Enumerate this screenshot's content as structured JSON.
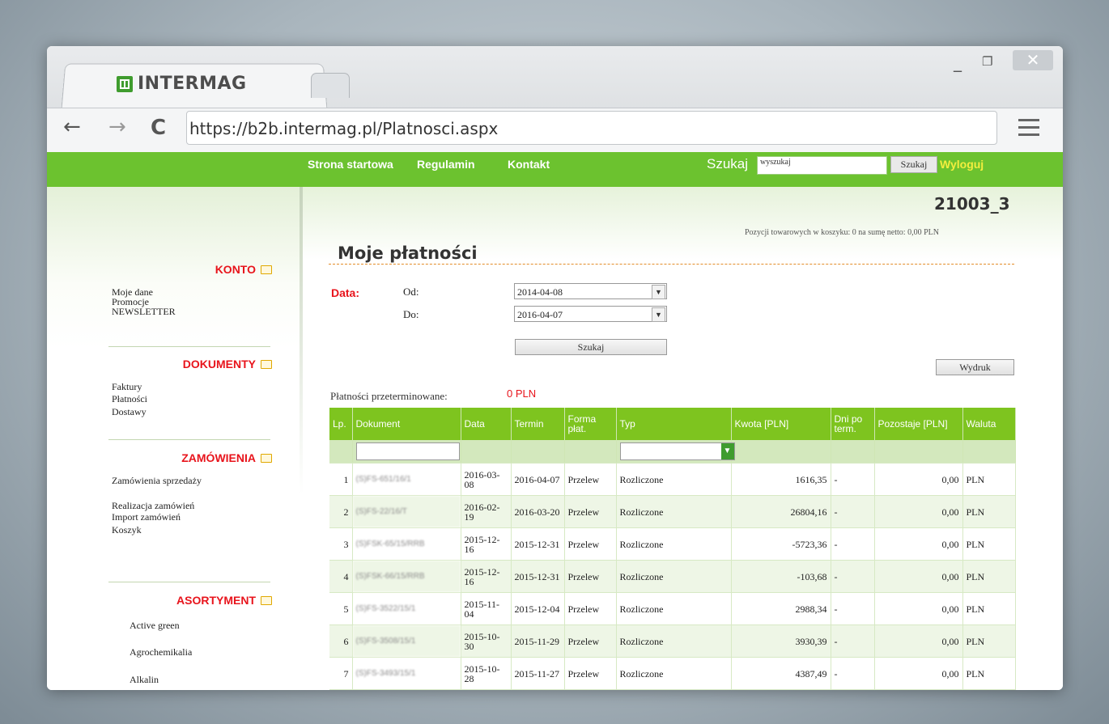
{
  "browser": {
    "tab_title": "INTERMAG",
    "url": "https://b2b.intermag.pl/Platnosci.aspx",
    "buttons": {
      "minimize": "_",
      "maximize": "❐",
      "close": "✕",
      "back": "←",
      "forward": "→",
      "reload": "C"
    }
  },
  "topnav": {
    "items": [
      "Strona startowa",
      "Regulamin",
      "Kontakt"
    ],
    "search_label": "Szukaj",
    "search_placeholder": "wyszukaj",
    "search_button": "Szukaj",
    "logout": "Wyloguj"
  },
  "sidebar": {
    "sections": [
      {
        "title": "KONTO",
        "items": [
          "Moje dane",
          "Promocje",
          "NEWSLETTER"
        ]
      },
      {
        "title": "DOKUMENTY",
        "items": [
          "Faktury",
          "Płatności",
          "Dostawy"
        ]
      },
      {
        "title": "ZAMÓWIENIA",
        "items": [
          "Zamówienia sprzedaży",
          "Realizacja zamówień",
          "Import zamówień",
          "Koszyk"
        ]
      },
      {
        "title": "ASORTYMENT",
        "items": [
          "Active green",
          "Agrochemikalia",
          "Alkalin"
        ]
      }
    ]
  },
  "header": {
    "account_id": "21003_3",
    "cart_info": "Pozycji towarowych w koszyku: 0 na sumę netto: 0,00 PLN"
  },
  "main": {
    "title": "Moje płatności",
    "filter": {
      "data_label": "Data:",
      "from_label": "Od:",
      "from_value": "2014-04-08",
      "to_label": "Do:",
      "to_value": "2016-04-07",
      "search_button": "Szukaj",
      "print_button": "Wydruk"
    },
    "overdue_label": "Płatności przeterminowane:",
    "overdue_value": "0 PLN",
    "table": {
      "headers": [
        "Lp.",
        "Dokument",
        "Data",
        "Termin",
        "Forma płat.",
        "Typ",
        "Kwota [PLN]",
        "Dni po term.",
        "Pozostaje [PLN]",
        "Waluta"
      ],
      "rows": [
        {
          "lp": "1",
          "doc": "(S)FS-651/16/1",
          "data": "2016-03-08",
          "termin": "2016-04-07",
          "forma": "Przelew",
          "typ": "Rozliczone",
          "kwota": "1616,35",
          "dni": "-",
          "pozostaje": "0,00",
          "waluta": "PLN"
        },
        {
          "lp": "2",
          "doc": "(S)FS-22/16/T",
          "data": "2016-02-19",
          "termin": "2016-03-20",
          "forma": "Przelew",
          "typ": "Rozliczone",
          "kwota": "26804,16",
          "dni": "-",
          "pozostaje": "0,00",
          "waluta": "PLN"
        },
        {
          "lp": "3",
          "doc": "(S)FSK-65/15/RRB",
          "data": "2015-12-16",
          "termin": "2015-12-31",
          "forma": "Przelew",
          "typ": "Rozliczone",
          "kwota": "-5723,36",
          "dni": "-",
          "pozostaje": "0,00",
          "waluta": "PLN"
        },
        {
          "lp": "4",
          "doc": "(S)FSK-66/15/RRB",
          "data": "2015-12-16",
          "termin": "2015-12-31",
          "forma": "Przelew",
          "typ": "Rozliczone",
          "kwota": "-103,68",
          "dni": "-",
          "pozostaje": "0,00",
          "waluta": "PLN"
        },
        {
          "lp": "5",
          "doc": "(S)FS-3522/15/1",
          "data": "2015-11-04",
          "termin": "2015-12-04",
          "forma": "Przelew",
          "typ": "Rozliczone",
          "kwota": "2988,34",
          "dni": "-",
          "pozostaje": "0,00",
          "waluta": "PLN"
        },
        {
          "lp": "6",
          "doc": "(S)FS-3508/15/1",
          "data": "2015-10-30",
          "termin": "2015-11-29",
          "forma": "Przelew",
          "typ": "Rozliczone",
          "kwota": "3930,39",
          "dni": "-",
          "pozostaje": "0,00",
          "waluta": "PLN"
        },
        {
          "lp": "7",
          "doc": "(S)FS-3493/15/1",
          "data": "2015-10-28",
          "termin": "2015-11-27",
          "forma": "Przelew",
          "typ": "Rozliczone",
          "kwota": "4387,49",
          "dni": "-",
          "pozostaje": "0,00",
          "waluta": "PLN"
        }
      ]
    }
  },
  "colors": {
    "brand_green": "#6cc22f",
    "header_green": "#7ec41f",
    "accent_red": "#e8141c",
    "logout_yellow": "#f3ee3e"
  }
}
